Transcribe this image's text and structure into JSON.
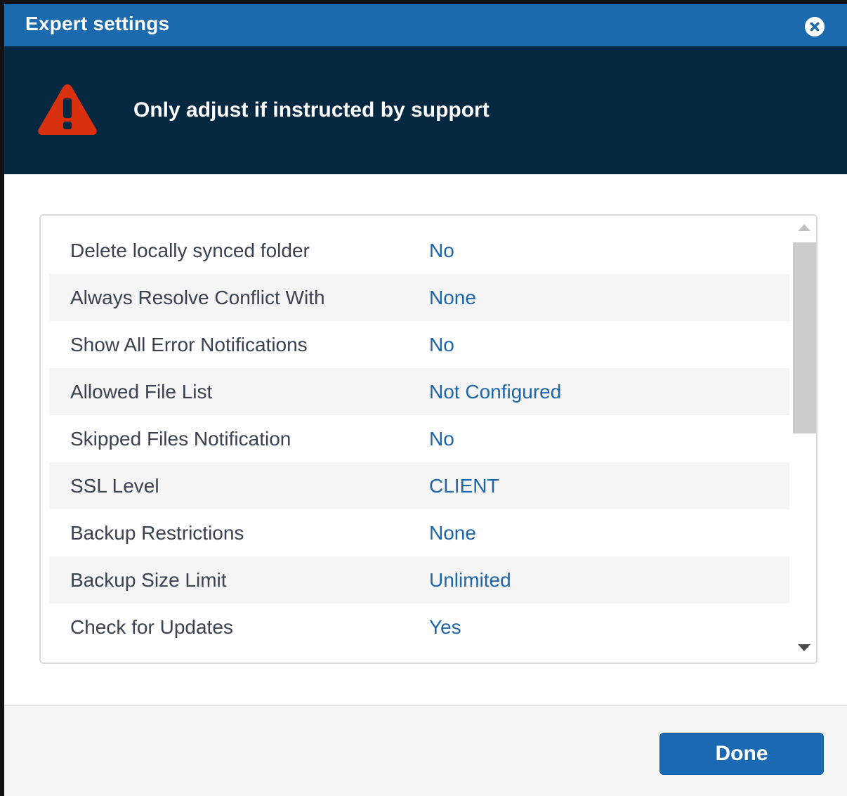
{
  "dialog": {
    "title": "Expert settings",
    "close_icon": "close-circle-icon"
  },
  "warning": {
    "icon": "warning-triangle-icon",
    "message": "Only adjust if instructed by support"
  },
  "settings": [
    {
      "label": "Delete locally synced folder",
      "value": "No"
    },
    {
      "label": "Always Resolve Conflict With",
      "value": "None"
    },
    {
      "label": "Show All Error Notifications",
      "value": "No"
    },
    {
      "label": "Allowed File List",
      "value": "Not Configured"
    },
    {
      "label": "Skipped Files Notification",
      "value": "No"
    },
    {
      "label": "SSL Level",
      "value": "CLIENT"
    },
    {
      "label": "Backup Restrictions",
      "value": "None"
    },
    {
      "label": "Backup Size Limit",
      "value": "Unlimited"
    },
    {
      "label": "Check for Updates",
      "value": "Yes"
    }
  ],
  "footer": {
    "done_label": "Done"
  },
  "colors": {
    "titlebar": "#1a6aad",
    "banner": "#072841",
    "warning_icon": "#d9300f",
    "link_value": "#1c65ad",
    "button": "#1b69b3"
  }
}
